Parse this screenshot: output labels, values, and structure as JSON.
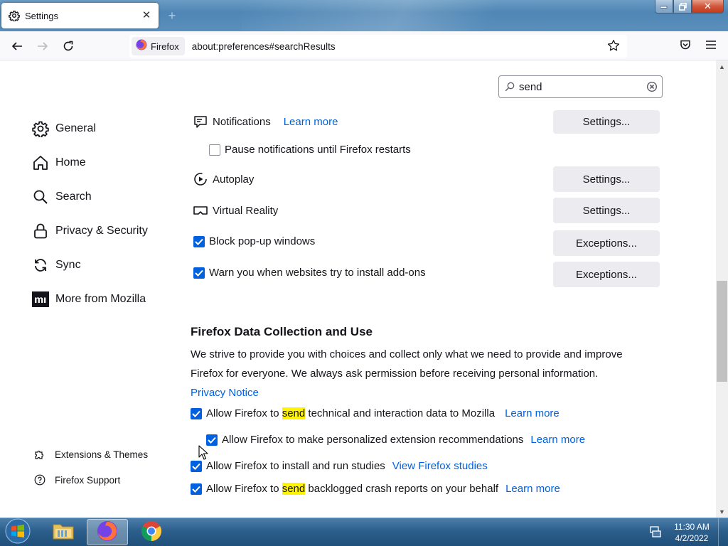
{
  "browser": {
    "tab": {
      "title": "Settings",
      "icon": "gear-icon"
    },
    "identity_label": "Firefox",
    "url": "about:preferences#searchResults"
  },
  "search": {
    "value": "send"
  },
  "sidebar": {
    "categories": [
      {
        "label": "General",
        "icon": "gear-icon"
      },
      {
        "label": "Home",
        "icon": "home-icon"
      },
      {
        "label": "Search",
        "icon": "search-icon"
      },
      {
        "label": "Privacy & Security",
        "icon": "lock-icon"
      },
      {
        "label": "Sync",
        "icon": "sync-icon"
      },
      {
        "label": "More from Mozilla",
        "icon": "mozilla-icon"
      }
    ],
    "footer": [
      {
        "label": "Extensions & Themes",
        "icon": "puzzle-icon"
      },
      {
        "label": "Firefox Support",
        "icon": "help-icon"
      }
    ]
  },
  "permissions": {
    "notifications": {
      "label": "Notifications",
      "learn_more": "Learn more",
      "button": "Settings..."
    },
    "pause_notifications": {
      "label": "Pause notifications until Firefox restarts",
      "checked": false
    },
    "autoplay": {
      "label": "Autoplay",
      "button": "Settings..."
    },
    "virtual_reality": {
      "label": "Virtual Reality",
      "button": "Settings..."
    },
    "block_popups": {
      "label": "Block pop-up windows",
      "checked": true,
      "button": "Exceptions..."
    },
    "warn_addons": {
      "label": "Warn you when websites try to install add-ons",
      "checked": true,
      "button": "Exceptions..."
    }
  },
  "data_collection": {
    "heading": "Firefox Data Collection and Use",
    "description_line1": "We strive to provide you with choices and collect only what we need to provide and improve",
    "description_line2": "Firefox for everyone. We always ask permission before receiving personal information.",
    "privacy_notice": "Privacy Notice",
    "technical_data": {
      "before": "Allow Firefox to ",
      "highlight": "send",
      "after": " technical and interaction data to Mozilla",
      "link": "Learn more",
      "checked": true
    },
    "extension_recs": {
      "label": "Allow Firefox to make personalized extension recommendations",
      "link": "Learn more",
      "checked": true
    },
    "studies": {
      "label": "Allow Firefox to install and run studies",
      "link": "View Firefox studies",
      "checked": true
    },
    "crash_reports": {
      "before": "Allow Firefox to ",
      "highlight": "send",
      "after": " backlogged crash reports on your behalf",
      "link": "Learn more",
      "checked": true
    }
  },
  "taskbar": {
    "time": "11:30 AM",
    "date": "4/2/2022",
    "apps": [
      "file-explorer-icon",
      "firefox-icon",
      "chrome-icon"
    ]
  },
  "colors": {
    "accent": "#0061e0",
    "highlight": "#fff300",
    "button_bg": "#ececf0"
  }
}
